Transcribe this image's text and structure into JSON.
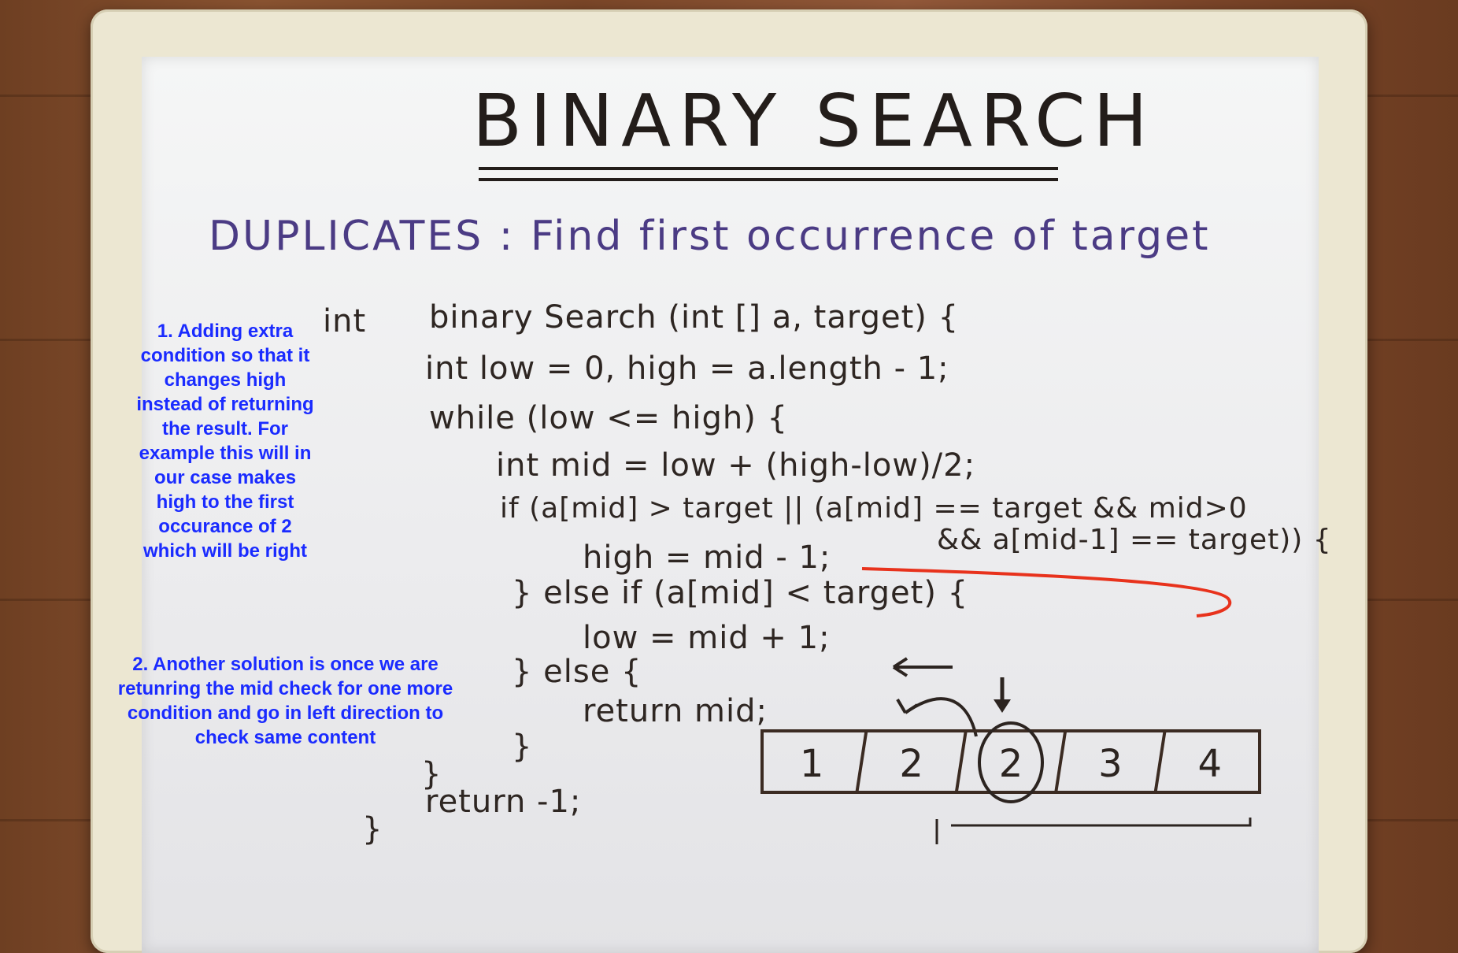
{
  "board": {
    "title": "BINARY SEARCH",
    "subtitle": "DUPLICATES : Find first occurrence of target",
    "code": [
      {
        "text": "int",
        "indent": 0
      },
      {
        "text": "binary Search (int [] a, target) {",
        "indent": 1
      },
      {
        "text": "int low = 0, high = a.length - 1;",
        "indent": 1
      },
      {
        "text": "while (low <= high) {",
        "indent": 1
      },
      {
        "text": "int mid = low + (high-low)/2;",
        "indent": 2
      },
      {
        "text": "if (a[mid] > target || (a[mid] == target && mid>0",
        "indent": 2
      },
      {
        "text": "&& a[mid-1] == target)) {",
        "indent": 4
      },
      {
        "text": "high = mid - 1;",
        "indent": 3
      },
      {
        "text": "} else if (a[mid] < target) {",
        "indent": 2
      },
      {
        "text": "low = mid + 1;",
        "indent": 3
      },
      {
        "text": "} else {",
        "indent": 2
      },
      {
        "text": "return mid;",
        "indent": 3
      },
      {
        "text": "}",
        "indent": 2
      },
      {
        "text": "}",
        "indent": 1
      },
      {
        "text": "return -1;",
        "indent": 1
      },
      {
        "text": "}",
        "indent": 0
      }
    ],
    "array": [
      "1",
      "2",
      "2",
      "3",
      "4"
    ],
    "circled_index": 2
  },
  "annotations": {
    "note1": "1. Adding extra condition so that it changes high instead of returning the result. For example this will in our case makes high to the first occurance of 2 which will be right",
    "note2": "2.  Another solution is once we are retunring the mid check for one more condition and go in left direction to check same content"
  },
  "colors": {
    "annotation_text": "#1a2bff",
    "subtitle_ink": "#4b3b84",
    "marker_ink": "#2c2420",
    "red_ink": "#e8321c"
  }
}
